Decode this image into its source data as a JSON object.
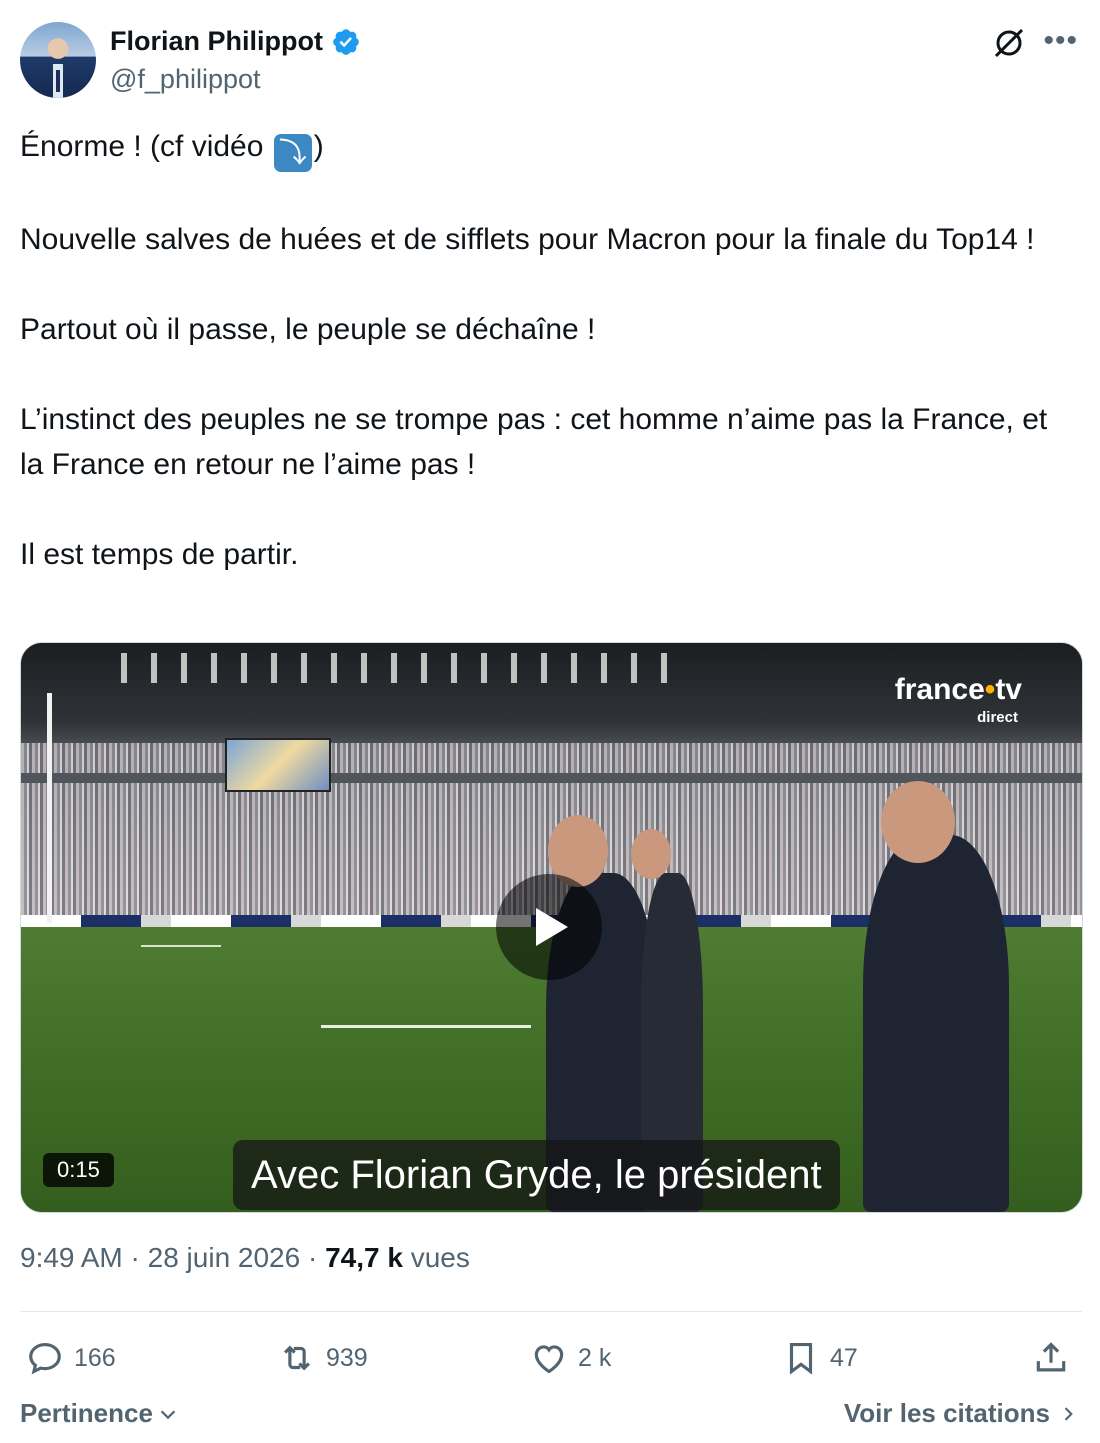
{
  "author": {
    "name": "Florian Philippot",
    "handle": "@f_philippot"
  },
  "icons": {
    "verified": "verified-badge-icon",
    "grok": "grok-icon",
    "more": "more-icon",
    "arrow_emoji": "right-arrow-curving-down-emoji"
  },
  "colors": {
    "verified_blue": "#1d9bf0",
    "text_primary": "#0f1419",
    "text_secondary": "#536471"
  },
  "tweet": {
    "line1_before": "Énorme ! (cf vidéo ",
    "line1_emoji": "⤵",
    "line1_after": ")",
    "p2": "Nouvelle salves de huées et de sifflets pour Macron pour la finale du Top14 !",
    "p3": "Partout où il passe, le peuple se déchaîne !",
    "p4": "L’instinct des peuples ne se trompe pas : cet homme n’aime pas la France, et la France en retour ne l’aime pas !",
    "p5": "Il est temps de partir."
  },
  "video": {
    "logo_main": "france",
    "logo_dot": "•",
    "logo_tv": "tv",
    "logo_sub": "direct",
    "duration": "0:15",
    "subtitle": "Avec Florian Gryde, le président"
  },
  "meta": {
    "time": "9:49 AM",
    "separator": " · ",
    "date": "28 juin 2026",
    "views_count": "74,7 k",
    "views_label": " vues"
  },
  "actions": {
    "replies": "166",
    "reposts": "939",
    "likes": "2 k",
    "bookmarks": "47"
  },
  "footer": {
    "sort_label": "Pertinence",
    "quotes_label": "Voir les citations"
  }
}
